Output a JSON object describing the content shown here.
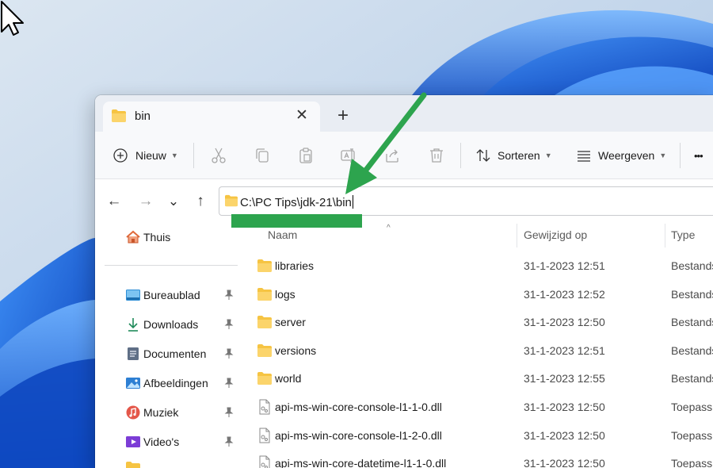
{
  "colors": {
    "accent_green": "#2da44e",
    "folder_yellow": "#f6c443",
    "wallpaper_blue": "#1e63d6"
  },
  "tab": {
    "title": "bin",
    "close_glyph": "✕",
    "new_tab_glyph": "+"
  },
  "commandbar": {
    "new_label": "Nieuw",
    "sort_label": "Sorteren",
    "view_label": "Weergeven",
    "more_glyph": "•••",
    "icons": [
      "cut-icon",
      "copy-icon",
      "paste-icon",
      "rename-icon",
      "share-icon",
      "delete-icon"
    ]
  },
  "navigation": {
    "back_glyph": "←",
    "forward_glyph": "→",
    "recent_glyph": "⌄",
    "up_glyph": "↑"
  },
  "address": {
    "path": "C:\\PC Tips\\jdk-21\\bin"
  },
  "sidebar": {
    "home": "Thuis",
    "quick_access": [
      {
        "label": "Bureaublad",
        "icon": "desktop-icon",
        "pinned": true
      },
      {
        "label": "Downloads",
        "icon": "download-icon",
        "pinned": true
      },
      {
        "label": "Documenten",
        "icon": "documents-icon",
        "pinned": true
      },
      {
        "label": "Afbeeldingen",
        "icon": "pictures-icon",
        "pinned": true
      },
      {
        "label": "Muziek",
        "icon": "music-icon",
        "pinned": true
      },
      {
        "label": "Video's",
        "icon": "videos-icon",
        "pinned": true
      }
    ]
  },
  "filelist": {
    "columns": {
      "name": "Naam",
      "modified": "Gewijzigd op",
      "type": "Type"
    },
    "sort_glyph": "^",
    "files": [
      {
        "name": "libraries",
        "modified": "31-1-2023 12:51",
        "type": "Bestands",
        "kind": "folder"
      },
      {
        "name": "logs",
        "modified": "31-1-2023 12:52",
        "type": "Bestands",
        "kind": "folder"
      },
      {
        "name": "server",
        "modified": "31-1-2023 12:50",
        "type": "Bestands",
        "kind": "folder"
      },
      {
        "name": "versions",
        "modified": "31-1-2023 12:51",
        "type": "Bestands",
        "kind": "folder"
      },
      {
        "name": "world",
        "modified": "31-1-2023 12:55",
        "type": "Bestands",
        "kind": "folder"
      },
      {
        "name": "api-ms-win-core-console-l1-1-0.dll",
        "modified": "31-1-2023 12:50",
        "type": "Toepassi",
        "kind": "dll"
      },
      {
        "name": "api-ms-win-core-console-l1-2-0.dll",
        "modified": "31-1-2023 12:50",
        "type": "Toepassi",
        "kind": "dll"
      },
      {
        "name": "api-ms-win-core-datetime-l1-1-0.dll",
        "modified": "31-1-2023 12:50",
        "type": "Toepassi",
        "kind": "dll"
      }
    ]
  }
}
